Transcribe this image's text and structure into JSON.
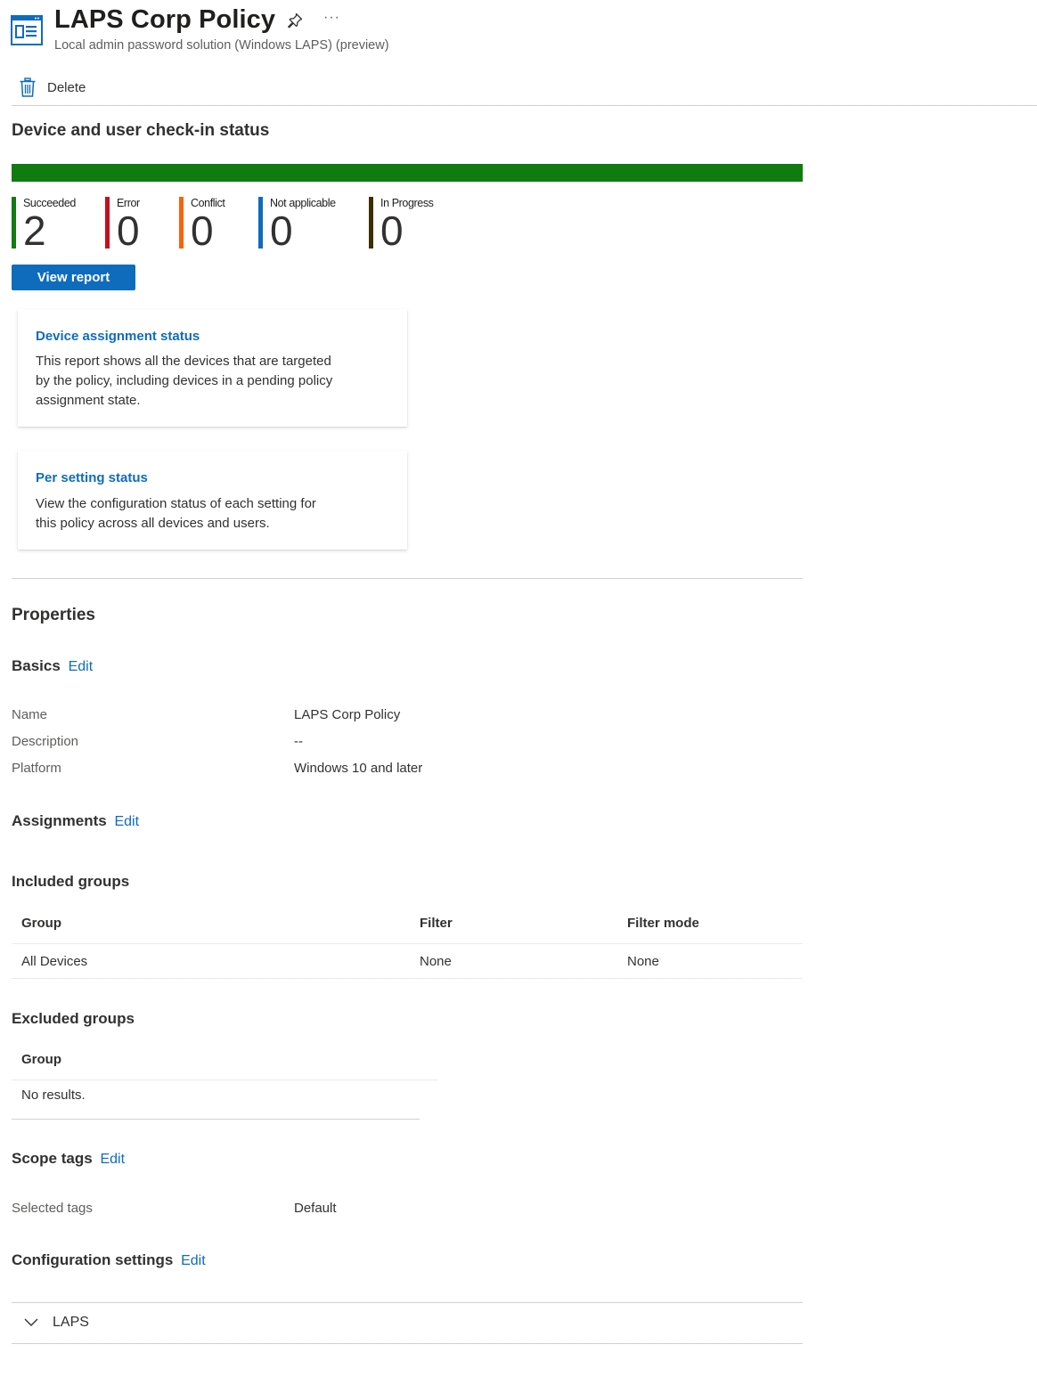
{
  "header": {
    "title": "LAPS Corp Policy",
    "subtitle": "Local admin password solution (Windows LAPS) (preview)",
    "more_label": "···"
  },
  "toolbar": {
    "delete_label": "Delete"
  },
  "checkin": {
    "title": "Device and user check-in status",
    "bar_color": "#107c10",
    "succeeded_fraction": 1.0,
    "stats": [
      {
        "label": "Succeeded",
        "value": "2",
        "color": "#107c10"
      },
      {
        "label": "Error",
        "value": "0",
        "color": "#c50f1f"
      },
      {
        "label": "Conflict",
        "value": "0",
        "color": "#f7630c"
      },
      {
        "label": "Not applicable",
        "value": "0",
        "color": "#0f6cbd"
      },
      {
        "label": "In Progress",
        "value": "0",
        "color": "#3d2e00"
      }
    ],
    "view_report_label": "View report"
  },
  "cards": [
    {
      "title": "Device assignment status",
      "description": "This report shows all the devices that are targeted by the policy, including devices in a pending policy assignment state."
    },
    {
      "title": "Per setting status",
      "description": "View the configuration status of each setting for this policy across all devices and users."
    }
  ],
  "properties": {
    "title": "Properties",
    "basics": {
      "title": "Basics",
      "edit_label": "Edit",
      "rows": [
        {
          "label": "Name",
          "value": "LAPS Corp Policy"
        },
        {
          "label": "Description",
          "value": "--"
        },
        {
          "label": "Platform",
          "value": "Windows 10 and later"
        }
      ]
    },
    "assignments": {
      "title": "Assignments",
      "edit_label": "Edit"
    },
    "included_groups": {
      "title": "Included groups",
      "columns": [
        "Group",
        "Filter",
        "Filter mode"
      ],
      "rows": [
        [
          "All Devices",
          "None",
          "None"
        ]
      ]
    },
    "excluded_groups": {
      "title": "Excluded groups",
      "columns": [
        "Group"
      ],
      "empty_text": "No results."
    },
    "scope_tags": {
      "title": "Scope tags",
      "edit_label": "Edit",
      "rows": [
        {
          "label": "Selected tags",
          "value": "Default"
        }
      ]
    },
    "configuration_settings": {
      "title": "Configuration settings",
      "edit_label": "Edit",
      "sections": [
        {
          "label": "LAPS",
          "expanded": false
        }
      ]
    }
  },
  "colors": {
    "accent": "#0f6cbd",
    "success": "#107c10"
  }
}
